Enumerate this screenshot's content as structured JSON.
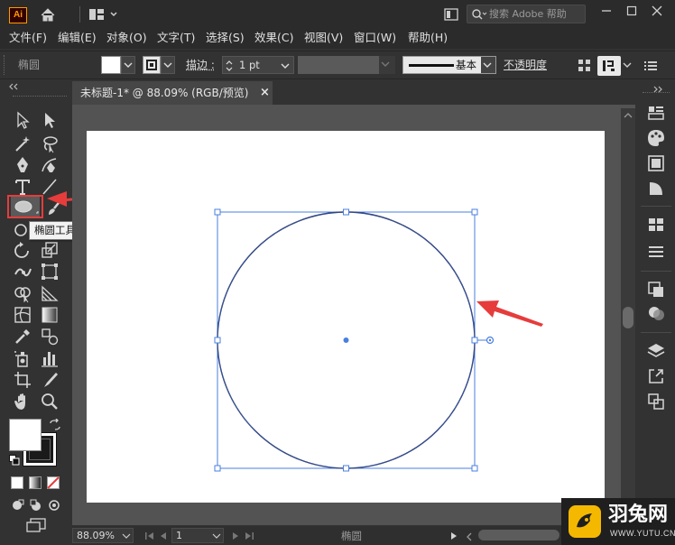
{
  "app": {
    "logo_text": "Ai"
  },
  "titlebar": {
    "search_placeholder": "搜索 Adobe 帮助"
  },
  "menu": [
    "文件(F)",
    "编辑(E)",
    "对象(O)",
    "文字(T)",
    "选择(S)",
    "效果(C)",
    "视图(V)",
    "窗口(W)",
    "帮助(H)"
  ],
  "control": {
    "object_type": "椭圆",
    "stroke_label": "描边",
    "stroke_weight": "1 pt",
    "brush_style": "基本",
    "opacity_label": "不透明度"
  },
  "document": {
    "tab_title": "未标题-1* @ 88.09% (RGB/预览)",
    "close_glyph": "×"
  },
  "tooltip": {
    "text": "椭圆工具 (L)"
  },
  "status": {
    "zoom": "88.09%",
    "page": "1",
    "tool_name": "椭圆"
  },
  "watermark": {
    "text": "羽兔网",
    "url": "WWW.YUTU.CN"
  },
  "colors": {
    "accent_selection": "#4a7fe0",
    "annotation_red": "#e63c3c",
    "circle_stroke": "#1f2a5e"
  }
}
